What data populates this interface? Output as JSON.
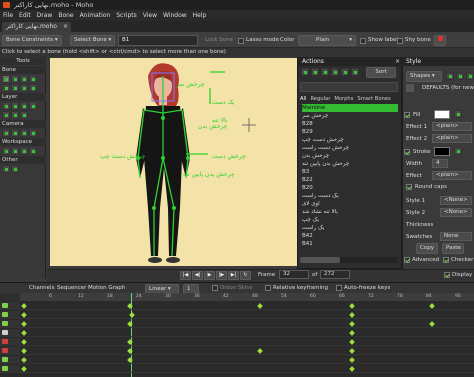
{
  "window": {
    "title": "نهایی کاراکتر.moho - Moho"
  },
  "menu": [
    "File",
    "Edit",
    "Draw",
    "Bone",
    "Animation",
    "Scripts",
    "View",
    "Window",
    "Help"
  ],
  "doc_tab": "نهایی کاراکتر.moho",
  "toolbar": {
    "bone_constraints": "Bone Constraints",
    "select_bone": "Select Bone",
    "bone_name": "B1",
    "lock_bone": "Lock bone",
    "lasso_mode": "Lasso mode",
    "color_label": "Color",
    "color_value": "Plain",
    "show_label": "Show label",
    "shy_bone": "Shy bone"
  },
  "hint": "Click to select a bone (hold <shift> or <ctrl/cmd> to select more than one bone)",
  "tools": {
    "title": "Tools",
    "bone": "Bone",
    "layer": "Layer",
    "camera": "Camera",
    "workspace": "Workspace",
    "other": "Other"
  },
  "canvas": {
    "labels": [
      "چرخش سر",
      "چرخش بدن",
      "چرخش دست چپ",
      "چرخش دست",
      "چرخش بدن پایین تنه",
      "بالا تنه",
      "یک دست"
    ],
    "accent": "#2fd12f"
  },
  "actions": {
    "title": "Actions",
    "sort_label": "Sort",
    "tabs": [
      "All",
      "Regular",
      "Morphs",
      "Smart Bones"
    ],
    "items": [
      "Mainline",
      "چرخش سر",
      "B28",
      "B29",
      "چرخش دست چپ",
      "چرخش دست راست",
      "چرخش بدن",
      "چرخش بدن پایین تنه",
      "B3",
      "B22",
      "B20",
      "یک دست راست",
      "اوی لای",
      "بالا تنه نشاد شد",
      "یک چپ",
      "یک راست",
      "B42",
      "B41"
    ],
    "selected_index": 0,
    "accent": "#33bb33"
  },
  "style": {
    "title": "Style",
    "shapes_btn": "Shapes",
    "defaults_label": "DEFAULTS (for new sh",
    "fill_label": "Fill",
    "effect1_label": "Effect 1",
    "effect1_value": "<plain>",
    "effect2_label": "Effect 2",
    "effect2_value": "<plain>",
    "stroke_label": "Stroke",
    "width_label": "Width",
    "width_value": "4",
    "effect_label": "Effect",
    "effect_value": "<plain>",
    "round_caps": "Round caps",
    "style1_label": "Style 1",
    "style1_value": "<None>",
    "style2_label": "Style 2",
    "style2_value": "<None>",
    "thickness_label": "Thickness",
    "swatches_label": "Swatches",
    "swatches_value": "None",
    "copy_btn": "Copy",
    "paste_btn": "Paste",
    "advanced_label": "Advanced",
    "checker_label": "Checker s",
    "fill_color": "#ffffff",
    "stroke_color": "#000000"
  },
  "playback": {
    "frame_label": "Frame",
    "frame_value": "32",
    "of_label": "of",
    "total_value": "272",
    "display_label": "Display ti"
  },
  "timeline": {
    "tabs": [
      "Channels",
      "Sequencer",
      "Motion Graph"
    ],
    "interp": "Linear",
    "interp_count": "1",
    "onion_skins": "Onion Skins",
    "relative_keyframing": "Relative keyframing",
    "auto_freeze": "Auto-freeze keys",
    "ruler_ticks": [
      "6",
      "12",
      "18",
      "24",
      "30",
      "36",
      "42",
      "48",
      "54",
      "60",
      "66",
      "72",
      "78",
      "84",
      "90"
    ]
  }
}
